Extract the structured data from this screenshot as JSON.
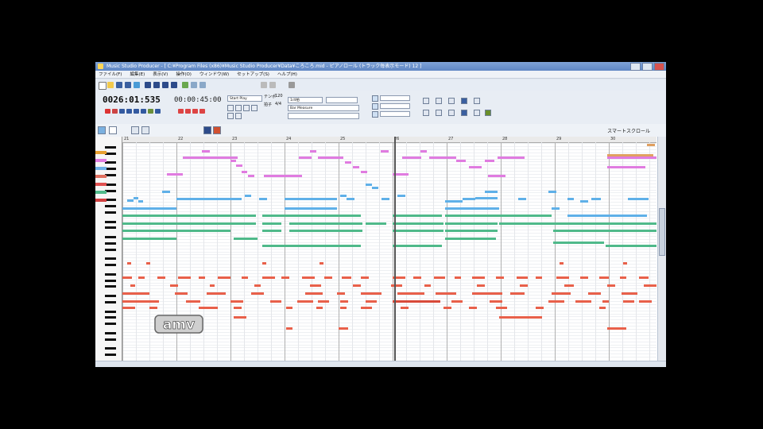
{
  "window": {
    "title": "Music Studio Producer - [ C:¥Program Files (x86)¥Music Studio Producer¥Data¥ころころ.mid - ピアノロール (トラック毎表示モード) 12 ]"
  },
  "menu": [
    "ファイル(F)",
    "編集(E)",
    "表示(V)",
    "操作(O)",
    "ウィンドウ(W)",
    "セットアップ(S)",
    "ヘルプ(H)"
  ],
  "transport": {
    "position": "0026:01:535",
    "time": "00:00:45:00",
    "tempo_label": "テンポ",
    "tempo_value": "120",
    "beat_label": "拍子",
    "beat_value": "4/4",
    "snap_label": "1/4拍",
    "display_label": "Bar Measure",
    "mode_label": "Start Play"
  },
  "subbar": {
    "scroll_label": "スマートスクロール"
  },
  "ruler": {
    "measures": [
      "21",
      "22",
      "23",
      "24",
      "25",
      "26",
      "27",
      "28",
      "29",
      "30"
    ]
  },
  "watermark": {
    "text": "amv"
  },
  "colors": {
    "pink": "#e07be0",
    "blue": "#5fb0e8",
    "teal": "#4fb98a",
    "red": "#e8604a",
    "orange": "#e0a060"
  }
}
